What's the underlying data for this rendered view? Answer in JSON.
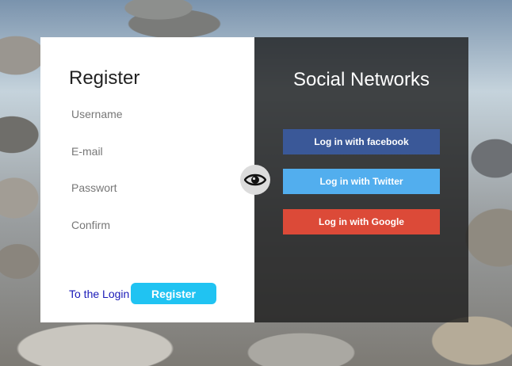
{
  "register": {
    "title": "Register",
    "username_placeholder": "Username",
    "email_placeholder": "E-mail",
    "password_placeholder": "Passwort",
    "confirm_placeholder": "Confirm",
    "login_link": "To the Login",
    "register_button": "Register"
  },
  "social": {
    "title": "Social Networks",
    "buttons": [
      {
        "label": "Log in with facebook",
        "color": "#3a5898"
      },
      {
        "label": "Log in with Twitter",
        "color": "#52aeee"
      },
      {
        "label": "Log in with Google",
        "color": "#dc4a38"
      }
    ]
  },
  "toggle": {
    "icon": "eye-icon"
  },
  "colors": {
    "accent": "#20c3f2",
    "link": "#1a1ab8"
  }
}
